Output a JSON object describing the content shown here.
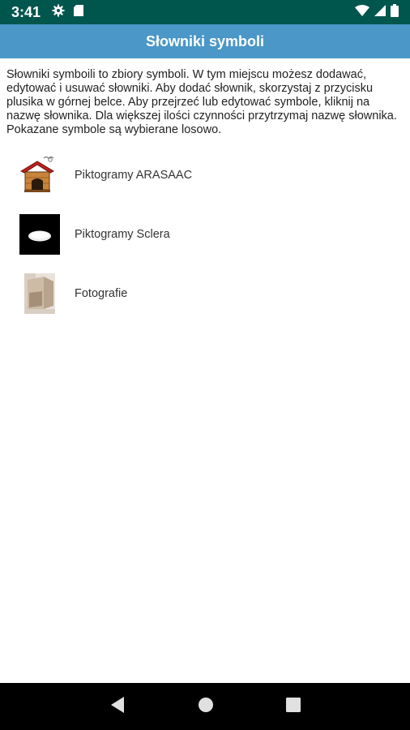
{
  "status_bar": {
    "time": "3:41",
    "icons": [
      "gear-icon",
      "sd-card-icon",
      "wifi-icon",
      "signal-icon",
      "battery-icon"
    ]
  },
  "app_bar": {
    "title": "Słowniki symboli",
    "color": "#4a97c8"
  },
  "description": "Słowniki symboili to zbiory symboli. W tym miejscu możesz dodawać, edytować i usuwać słowniki. Aby dodać słownik, skorzystaj z przycisku plusika w górnej belce. Aby przejrzeć lub edytować symbole, kliknij na nazwę słownika. Dla większej ilości czynności przytrzymaj nazwę słownika. Pokazane symbole są wybierane losowo.",
  "dictionaries": [
    {
      "label": "Piktogramy ARASAAC",
      "icon": "doghouse-icon"
    },
    {
      "label": "Piktogramy Sclera",
      "icon": "plate-icon"
    },
    {
      "label": "Fotografie",
      "icon": "photo-thumbnail"
    }
  ],
  "nav_bar": {
    "buttons": [
      "back-icon",
      "home-icon",
      "recents-icon"
    ]
  }
}
